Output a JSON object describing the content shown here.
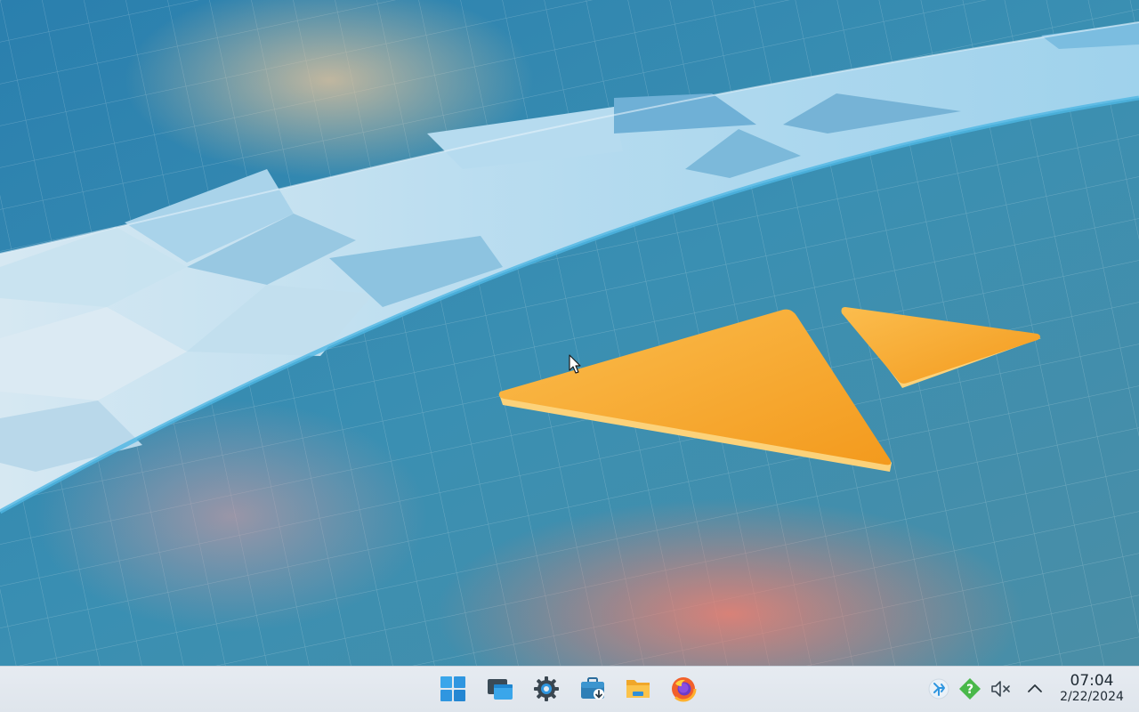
{
  "desktop": {
    "wallpaper_name": "kde-plasma-default-wallpaper",
    "colors": {
      "sea_blue": "#2f86b0",
      "ice_band": "#bcdff0",
      "orange": "#f6a32a",
      "coral_glow": "#f07a6e"
    }
  },
  "taskbar": {
    "pinned": [
      {
        "name": "start-menu",
        "icon": "windows-logo-icon"
      },
      {
        "name": "task-view",
        "icon": "task-view-icon"
      },
      {
        "name": "system-settings",
        "icon": "gear-icon"
      },
      {
        "name": "discover",
        "icon": "software-store-icon"
      },
      {
        "name": "file-manager",
        "icon": "folder-icon"
      },
      {
        "name": "firefox",
        "icon": "firefox-icon"
      }
    ],
    "tray": [
      {
        "name": "kde-connect",
        "icon": "kde-connect-icon"
      },
      {
        "name": "help",
        "icon": "help-icon",
        "symbol": "?"
      },
      {
        "name": "volume",
        "icon": "volume-muted-icon"
      },
      {
        "name": "show-hidden",
        "icon": "chevron-up-icon"
      }
    ],
    "clock": {
      "time": "07:04",
      "date": "2/22/2024"
    }
  }
}
